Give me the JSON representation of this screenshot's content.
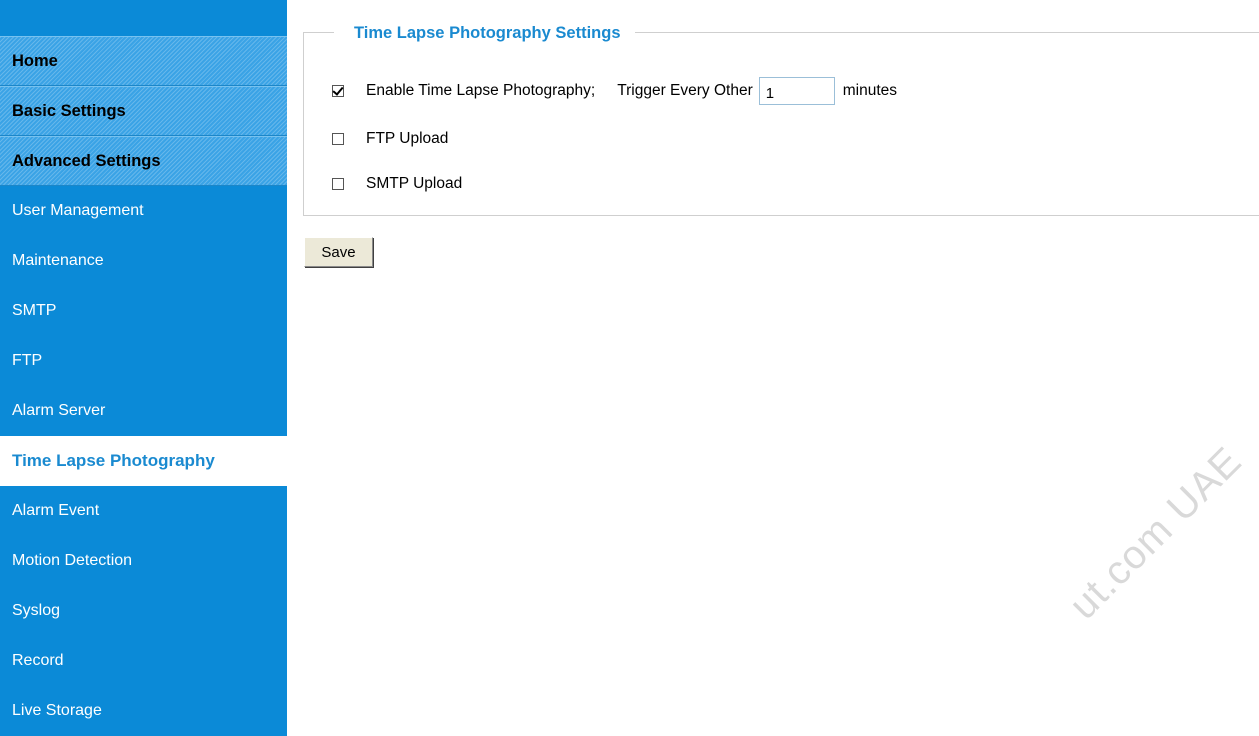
{
  "sidebar": {
    "sections": [
      {
        "label": "Home"
      },
      {
        "label": "Basic Settings"
      },
      {
        "label": "Advanced Settings"
      }
    ],
    "links": [
      {
        "label": "User Management"
      },
      {
        "label": "Maintenance"
      },
      {
        "label": "SMTP"
      },
      {
        "label": "FTP"
      },
      {
        "label": "Alarm Server"
      }
    ],
    "active": {
      "label": "Time Lapse Photography"
    },
    "links_after": [
      {
        "label": "Alarm Event"
      },
      {
        "label": "Motion Detection"
      },
      {
        "label": "Syslog"
      },
      {
        "label": "Record"
      },
      {
        "label": "Live Storage"
      }
    ]
  },
  "settings": {
    "legend": "Time Lapse Photography Settings",
    "enable": {
      "label": "Enable Time Lapse Photography;",
      "checked": true
    },
    "trigger": {
      "label": "Trigger Every Other",
      "value": "1",
      "unit": "minutes"
    },
    "ftp": {
      "label": "FTP Upload",
      "checked": false
    },
    "smtp": {
      "label": "SMTP Upload",
      "checked": false
    }
  },
  "save_label": "Save",
  "watermark": "ut.com UAE",
  "colors": {
    "accent": "#1a8ad0",
    "sidebar_bg": "#0b8ad7"
  }
}
